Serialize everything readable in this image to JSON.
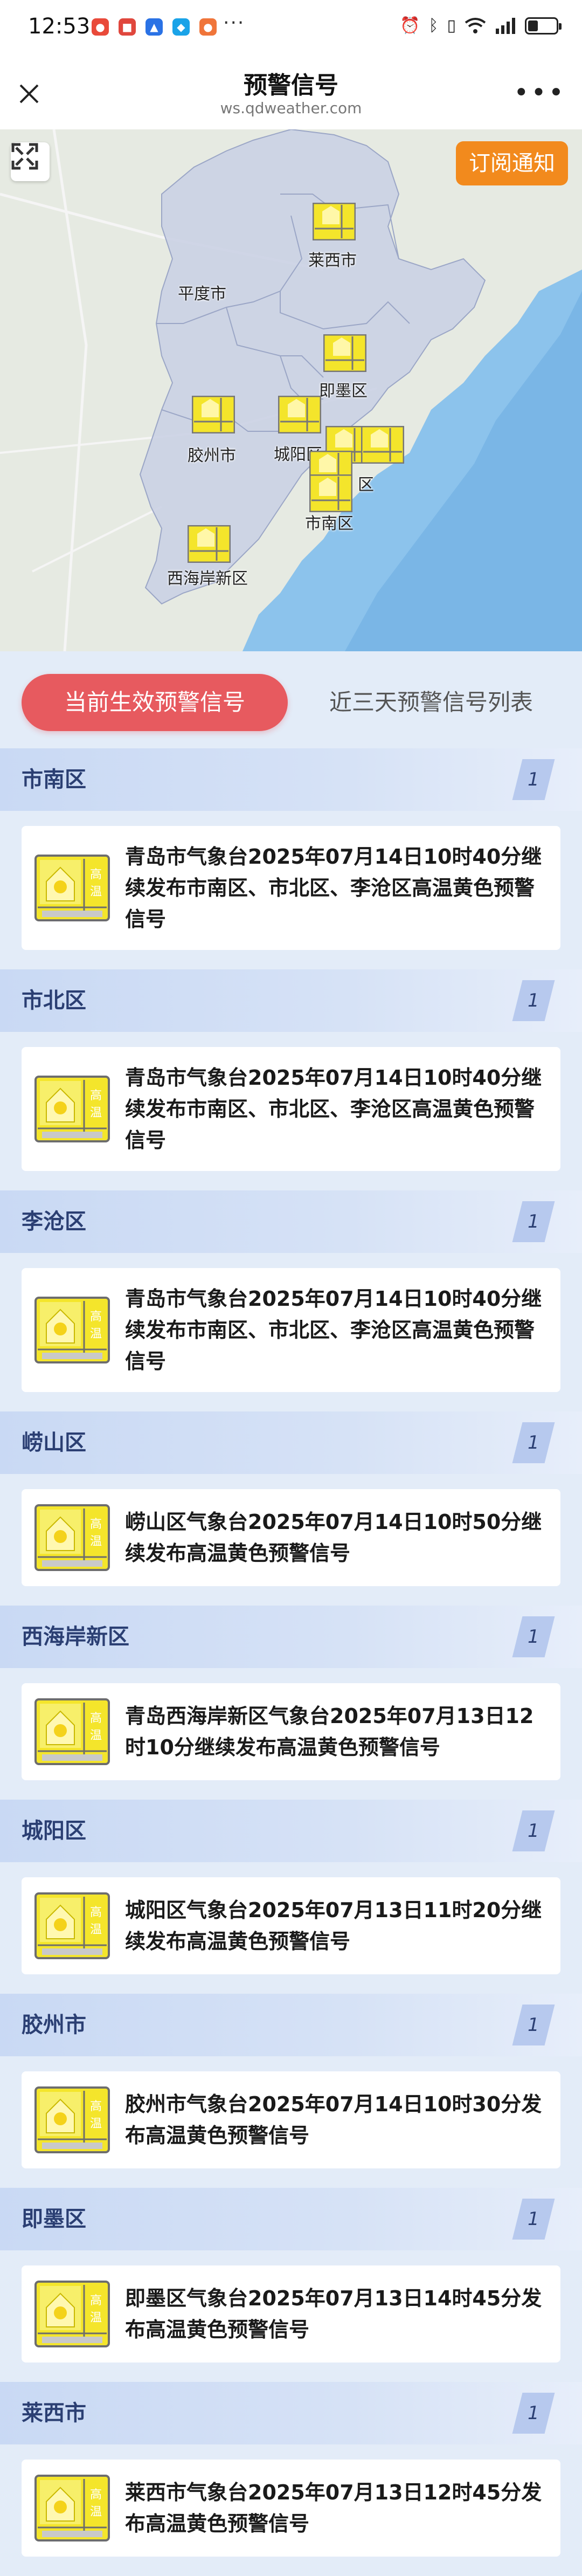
{
  "status_bar": {
    "time": "12:53",
    "more": "···"
  },
  "header": {
    "title": "预警信号",
    "url": "ws.qdweather.com"
  },
  "map": {
    "subscribe_label": "订阅通知",
    "labels": {
      "pingdu": "平度市",
      "laixi": "莱西市",
      "jimo": "即墨区",
      "jiaozhou": "胶州市",
      "chengyang": "城阳区",
      "shinan": "市南区",
      "qu": "区",
      "xihaian": "西海岸新区"
    }
  },
  "tabs": {
    "active": "当前生效预警信号",
    "inactive": "近三天预警信号列表"
  },
  "icon": {
    "name": "high-temperature-yellow-warning-icon",
    "color": "#f4e52b",
    "glyph": "高温"
  },
  "sections": [
    {
      "name": "市南区",
      "count": "1",
      "text": "青岛市气象台2025年07月14日10时40分继续发布市南区、市北区、李沧区高温黄色预警信号"
    },
    {
      "name": "市北区",
      "count": "1",
      "text": "青岛市气象台2025年07月14日10时40分继续发布市南区、市北区、李沧区高温黄色预警信号"
    },
    {
      "name": "李沧区",
      "count": "1",
      "text": "青岛市气象台2025年07月14日10时40分继续发布市南区、市北区、李沧区高温黄色预警信号"
    },
    {
      "name": "崂山区",
      "count": "1",
      "text": "崂山区气象台2025年07月14日10时50分继续发布高温黄色预警信号"
    },
    {
      "name": "西海岸新区",
      "count": "1",
      "text": "青岛西海岸新区气象台2025年07月13日12时10分继续发布高温黄色预警信号"
    },
    {
      "name": "城阳区",
      "count": "1",
      "text": "城阳区气象台2025年07月13日11时20分继续发布高温黄色预警信号"
    },
    {
      "name": "胶州市",
      "count": "1",
      "text": "胶州市气象台2025年07月14日10时30分发布高温黄色预警信号"
    },
    {
      "name": "即墨区",
      "count": "1",
      "text": "即墨区气象台2025年07月13日14时45分发布高温黄色预警信号"
    },
    {
      "name": "莱西市",
      "count": "1",
      "text": "莱西市气象台2025年07月13日12时45分发布高温黄色预警信号"
    }
  ]
}
